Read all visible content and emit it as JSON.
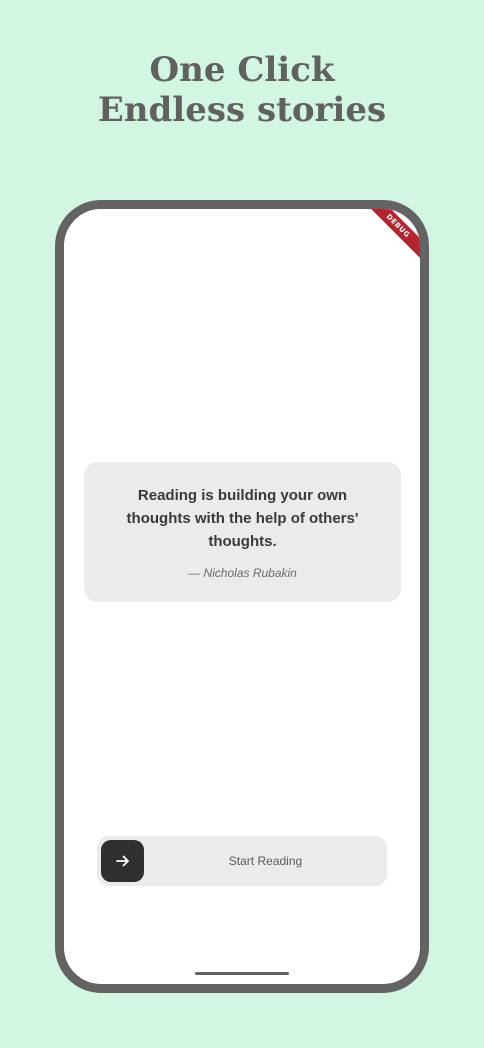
{
  "hero": {
    "line1": "One Click",
    "line2": "Endless stories"
  },
  "debug_banner": "DEBUG",
  "quote": {
    "text": "Reading is building your own thoughts with the help of others' thoughts.",
    "author": "— Nicholas Rubakin"
  },
  "start": {
    "label": "Start Reading",
    "icon": "arrow-right-icon"
  },
  "colors": {
    "background": "#d2f6e2",
    "frame": "#636363",
    "card": "#ebebeb",
    "button": "#2f2f2f",
    "ribbon": "#b4252f",
    "headline": "#5f625f"
  }
}
